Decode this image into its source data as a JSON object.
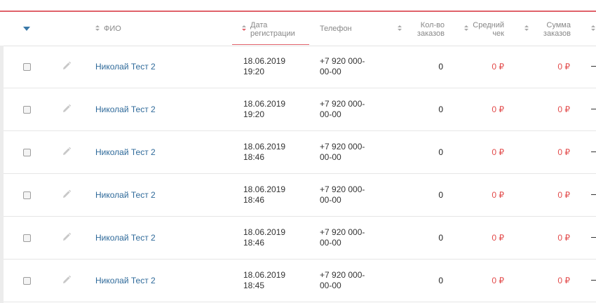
{
  "header": {
    "fio": "ФИО",
    "date_line1": "Дата",
    "date_line2": "регистрации",
    "phone": "Телефон",
    "count_line1": "Кол-во",
    "count_line2": "заказов",
    "avg_line1": "Средний",
    "avg_line2": "чек",
    "sum_line1": "Сумма",
    "sum_line2": "заказов"
  },
  "accent_color": "#e0626a",
  "link_color": "#2f6a9a",
  "rows": [
    {
      "name": "Николай Тест 2",
      "date": "18.06.2019",
      "time": "19:20",
      "phone1": "+7 920 000-",
      "phone2": "00-00",
      "count": "0",
      "avg": "0 ₽",
      "sum": "0 ₽"
    },
    {
      "name": "Николай Тест 2",
      "date": "18.06.2019",
      "time": "19:20",
      "phone1": "+7 920 000-",
      "phone2": "00-00",
      "count": "0",
      "avg": "0 ₽",
      "sum": "0 ₽"
    },
    {
      "name": "Николай Тест 2",
      "date": "18.06.2019",
      "time": "18:46",
      "phone1": "+7 920 000-",
      "phone2": "00-00",
      "count": "0",
      "avg": "0 ₽",
      "sum": "0 ₽"
    },
    {
      "name": "Николай Тест 2",
      "date": "18.06.2019",
      "time": "18:46",
      "phone1": "+7 920 000-",
      "phone2": "00-00",
      "count": "0",
      "avg": "0 ₽",
      "sum": "0 ₽"
    },
    {
      "name": "Николай Тест 2",
      "date": "18.06.2019",
      "time": "18:46",
      "phone1": "+7 920 000-",
      "phone2": "00-00",
      "count": "0",
      "avg": "0 ₽",
      "sum": "0 ₽"
    },
    {
      "name": "Николай Тест 2",
      "date": "18.06.2019",
      "time": "18:45",
      "phone1": "+7 920 000-",
      "phone2": "00-00",
      "count": "0",
      "avg": "0 ₽",
      "sum": "0 ₽"
    }
  ]
}
